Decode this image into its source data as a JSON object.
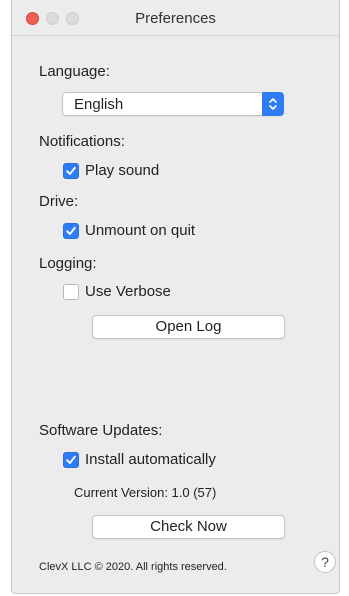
{
  "window": {
    "title": "Preferences"
  },
  "language": {
    "label": "Language:",
    "selected": "English"
  },
  "notifications": {
    "label": "Notifications:",
    "play_sound": {
      "label": "Play sound",
      "checked": true
    }
  },
  "drive": {
    "label": "Drive:",
    "unmount_on_quit": {
      "label": "Unmount on quit",
      "checked": true
    }
  },
  "logging": {
    "label": "Logging:",
    "use_verbose": {
      "label": "Use Verbose",
      "checked": false
    },
    "open_log_button": "Open Log"
  },
  "software_updates": {
    "label": "Software Updates:",
    "install_automatically": {
      "label": "Install automatically",
      "checked": true
    },
    "current_version": "Current Version:  1.0 (57)",
    "check_now_button": "Check Now"
  },
  "footer": {
    "copyright": "ClevX LLC © 2020. All rights reserved.",
    "help_glyph": "?"
  },
  "colors": {
    "accent": "#2f7df6",
    "close": "#ee5f56",
    "window_bg": "#ececec"
  },
  "icons": {
    "close": "close-traffic-light",
    "minimize": "minimize-traffic-light",
    "zoom": "zoom-traffic-light",
    "select_arrows": "chevron-up-down-icon",
    "checkmark": "checkmark-icon",
    "help": "question-mark-icon"
  }
}
